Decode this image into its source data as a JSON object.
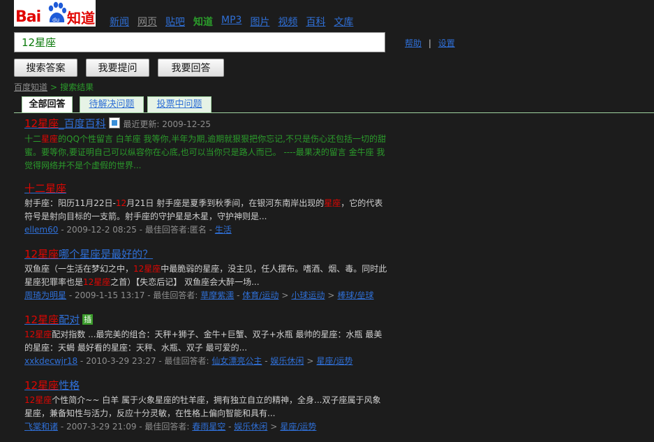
{
  "logo": {
    "left": "Bai",
    "right": "知道",
    "paw_text": "du"
  },
  "nav": {
    "items": [
      "新闻",
      "网页",
      "贴吧",
      "知道",
      "MP3",
      "图片",
      "视频",
      "百科",
      "文库"
    ],
    "current_index": 3
  },
  "search": {
    "value": "12星座"
  },
  "help": {
    "help_label": "帮助",
    "separator": "|",
    "settings_label": "设置"
  },
  "buttons": {
    "search_answers": "搜索答案",
    "ask": "我要提问",
    "answer": "我要回答"
  },
  "breadcrumb": {
    "home": "百度知道",
    "sep": ">",
    "current": "搜索结果"
  },
  "tabs": {
    "all": "全部回答",
    "pending": "待解决问题",
    "voting": "投票中问题"
  },
  "results": [
    {
      "title_hl": "12星座",
      "title_rest": "_百度百科",
      "badge_updated": "最近更新: 2009-12-25",
      "snippet_parts": [
        "十二",
        "星座",
        "的QQ个性留言 白羊座 我等你,半年为期,逾期就狠狠把你忘记,不只是伤心还包括一切的甜蜜。要等你,要证明自己可以纵容你在心底,也可以当你只是路人而已。 ----最果决的留言 金牛座 我觉得网络并不是个虚假的世界..."
      ]
    },
    {
      "title": "十二星座",
      "snippet_parts": [
        "射手座：阳历11月22日-",
        "12",
        "月21日 射手座是夏季到秋季间，在银河东南岸出现的",
        "星座",
        "，它的代表符号是射向目标的一支箭。射手座的守护星是木星，守护神则是..."
      ],
      "meta_user": "ellem60",
      "meta_date": " - 2009-12-2 08:25 - 最佳回答者:匿名 - ",
      "meta_cats": [
        "生活"
      ]
    },
    {
      "title_hl": "12星座",
      "title_rest": "哪个星座是最好的？",
      "snippet_parts": [
        "双鱼座（一生活在梦幻之中，",
        "12星座",
        "中最脆弱的星座，没主见，任人摆布。嗜酒、烟、毒。同时此星座犯罪率也是",
        "12星座",
        "之首）【失恋后记】 双鱼座会大醉一场..."
      ],
      "meta_user": "周琦为明星",
      "meta_date": " - 2009-1-15 13:17 - 最佳回答者: ",
      "meta_answerer": "草摩紫濡",
      "meta_cats": [
        "体育/运动",
        "小球运动",
        "棒球/垒球"
      ]
    },
    {
      "title_hl": "12星座",
      "title_rest": "配对",
      "tag": "插",
      "snippet_parts": [
        "12星座",
        "配对指数 ...最完美的组合：天秤+狮子、金牛+巨蟹、双子+水瓶 最帅的星座：水瓶 最美的星座：天蝎 最好看的星座：天秤、水瓶、双子 最可爱的..."
      ],
      "meta_user": "xxkdecwjr18",
      "meta_date": " - 2010-3-29 23:27 - 最佳回答者: ",
      "meta_answerer": "仙女漂亮公主",
      "meta_cats": [
        "娱乐休闲",
        "星座/运势"
      ]
    },
    {
      "title_hl": "12星座",
      "title_rest": "性格",
      "snippet_parts": [
        "12星座",
        "个性简介~~ 白羊 属于火象星座的牡羊座，拥有独立自立的精神，全身...双子座属于风象星座，兼备知性与活力，反应十分灵敏，在性格上偏向智能和具有..."
      ],
      "meta_user": "飞棠和诸",
      "meta_date": " - 2007-3-29 21:09 - 最佳回答者: ",
      "meta_answerer": "春雨星空",
      "meta_cats": [
        "娱乐休闲",
        "星座/运势"
      ]
    }
  ]
}
